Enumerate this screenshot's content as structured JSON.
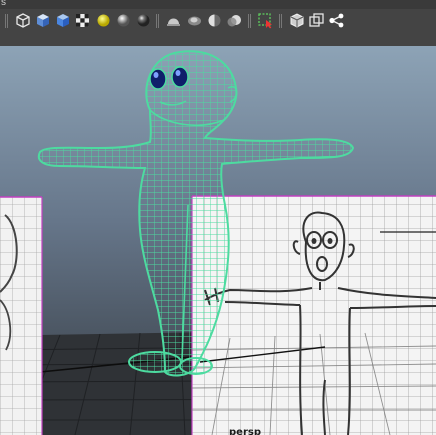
{
  "toolbar": {
    "left_fragment": "s",
    "icons": [
      "wireframe-cube-icon",
      "smooth-shade-cube-icon",
      "textured-cube-icon",
      "checker-icon",
      "use-all-lights-icon",
      "default-light-sphere-icon",
      "shaded-sphere-icon",
      "hemisphere-icon",
      "ambient-occlusion-icon",
      "half-sphere-icon",
      "motion-blur-sphere-icon",
      "select-highlight-icon",
      "isolate-select-icon",
      "xray-icon",
      "share-node-icon"
    ]
  },
  "viewport": {
    "camera_label": "persp"
  },
  "colors": {
    "mesh": "#4ddba0",
    "grid": "#b0b0b0",
    "image_plane_border": "#c040c0",
    "gradient_top": "#8aa0b3",
    "gradient_bottom": "#3a3f45"
  }
}
